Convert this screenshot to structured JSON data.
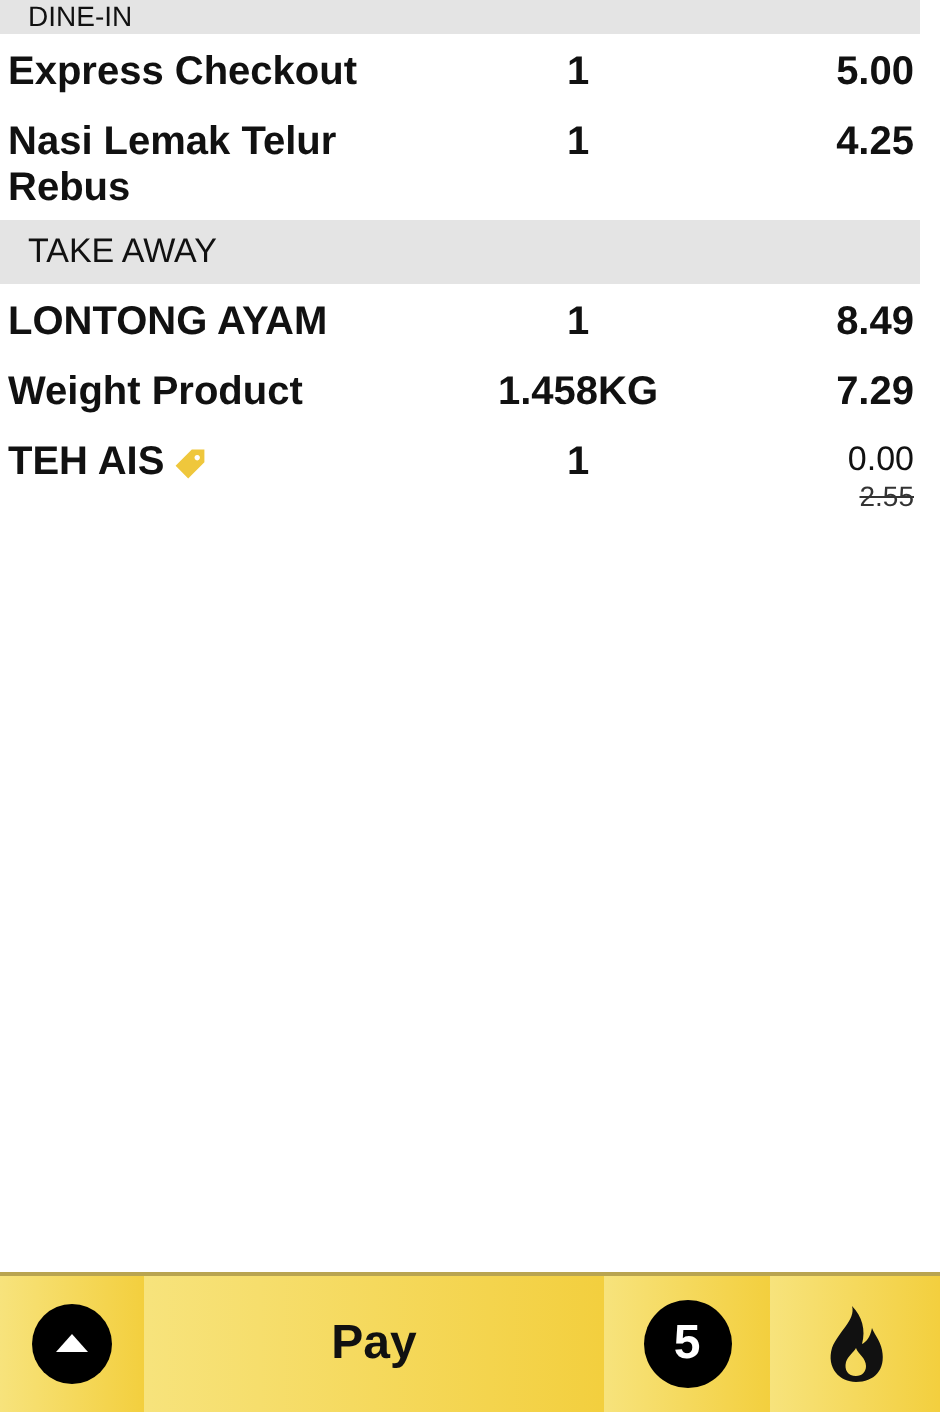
{
  "sections": [
    {
      "title": "DINE-IN",
      "items": [
        {
          "name": "Express Checkout",
          "qty": "1",
          "price": "5.00"
        },
        {
          "name": "Nasi Lemak Telur Rebus",
          "qty": "1",
          "price": "4.25"
        }
      ]
    },
    {
      "title": "TAKE AWAY",
      "items": [
        {
          "name": "LONTONG AYAM",
          "qty": "1",
          "price": "8.49"
        },
        {
          "name": "Weight Product",
          "qty": "1.458KG",
          "price": "7.29"
        },
        {
          "name": "TEH AIS",
          "qty": "1",
          "price": "0.00",
          "original_price": "2.55",
          "discounted": true
        }
      ]
    }
  ],
  "bottom_bar": {
    "pay_label": "Pay",
    "count": "5"
  }
}
